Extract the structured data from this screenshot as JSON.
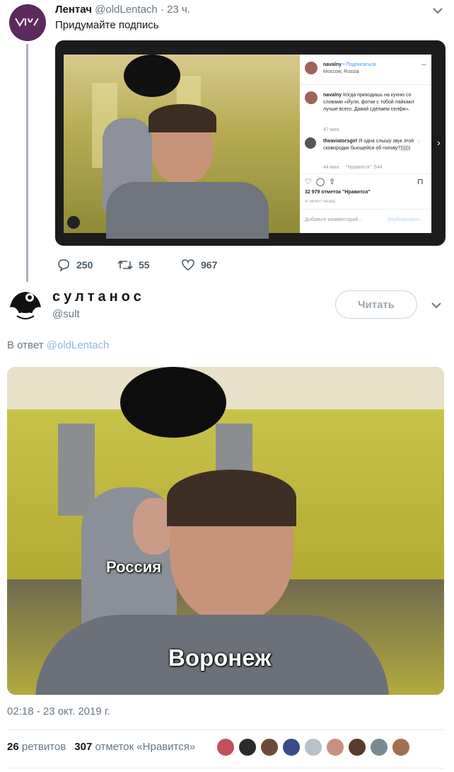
{
  "parent_tweet": {
    "display_name": "Лентач",
    "handle": "@oldLentach",
    "time": "23 ч.",
    "text": "Придумайте подпись",
    "instagram": {
      "username": "navalny",
      "follow_label": "• Подписаться",
      "location": "Moscow, Russia",
      "caption_user": "navalny",
      "caption": "Когда приходишь на кухню со словами «Йуля, фотки с тобой лайкают лучше всего. Давай сделаем селфи».",
      "caption_time": "47 мин.",
      "comment_user": "theaviatorsgirl",
      "comment": "Я одна слышу звук этой сковородки бьющейся об голову?))))))",
      "comment_time": "44 мин.",
      "comment_likes": "\"Нравится\": 544",
      "likes": "32 979 отметок \"Нравится\"",
      "posted": "47 МИНУТ НАЗАД",
      "comment_placeholder": "Добавьте комментарий...",
      "publish_label": "Опубликовать"
    },
    "actions": {
      "replies": "250",
      "retweets": "55",
      "likes": "967"
    }
  },
  "reply_tweet": {
    "display_name": "султанос",
    "handle": "@sult",
    "follow_label": "Читать",
    "reply_prefix": "В ответ",
    "reply_to": "@oldLentach",
    "caption_top": "Россия",
    "caption_bottom": "Воронеж",
    "timestamp": "02:18 - 23 окт. 2019 г.",
    "retweets_count": "26",
    "retweets_label": "ретвитов",
    "likes_count": "307",
    "likes_label": "отметок «Нравится»"
  }
}
